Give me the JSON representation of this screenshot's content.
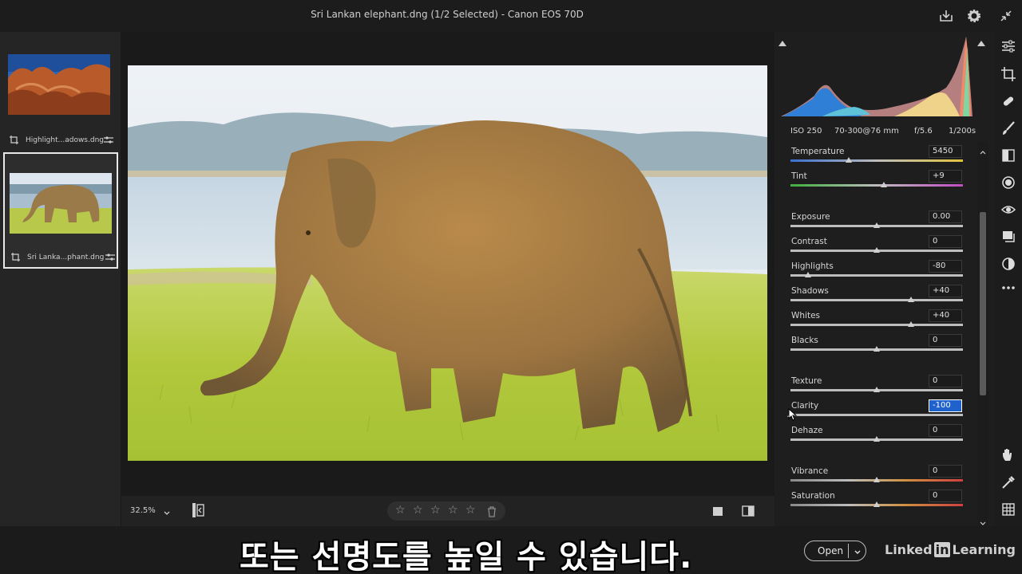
{
  "window": {
    "title": "Sri Lankan elephant.dng (1/2 Selected)  -  Canon EOS 70D"
  },
  "filmstrip": {
    "items": [
      {
        "label": "Highlight...adows.dng",
        "selected": false
      },
      {
        "label": "Sri Lanka...phant.dng",
        "selected": true
      }
    ]
  },
  "bottombar": {
    "zoom": "32.5%",
    "stars": [
      "☆",
      "☆",
      "☆",
      "☆",
      "☆"
    ]
  },
  "exif": {
    "iso": "ISO 250",
    "lens": "70-300@76 mm",
    "aperture": "f/5.6",
    "shutter": "1/200s"
  },
  "adjustments": [
    {
      "label": "Temperature",
      "value": "5450",
      "pos": 0.34,
      "track": "temp"
    },
    {
      "label": "Tint",
      "value": "+9",
      "pos": 0.54,
      "track": "tint"
    },
    {
      "label": "Exposure",
      "value": "0.00",
      "pos": 0.5,
      "track": "gray"
    },
    {
      "label": "Contrast",
      "value": "0",
      "pos": 0.5,
      "track": "gray"
    },
    {
      "label": "Highlights",
      "value": "-80",
      "pos": 0.1,
      "track": "gray"
    },
    {
      "label": "Shadows",
      "value": "+40",
      "pos": 0.7,
      "track": "gray"
    },
    {
      "label": "Whites",
      "value": "+40",
      "pos": 0.7,
      "track": "gray"
    },
    {
      "label": "Blacks",
      "value": "0",
      "pos": 0.5,
      "track": "gray"
    },
    {
      "label": "Texture",
      "value": "0",
      "pos": 0.5,
      "track": "gray"
    },
    {
      "label": "Clarity",
      "value": "-100",
      "pos": 0.0,
      "track": "gray",
      "active": true
    },
    {
      "label": "Dehaze",
      "value": "0",
      "pos": 0.5,
      "track": "gray"
    },
    {
      "label": "Vibrance",
      "value": "0",
      "pos": 0.5,
      "track": "vib"
    },
    {
      "label": "Saturation",
      "value": "0",
      "pos": 0.5,
      "track": "vib"
    }
  ],
  "footer": {
    "subtitle": "또는 선명도를 높일 수 있습니다.",
    "open_label": "Open",
    "brand_a": "Linked",
    "brand_in": "in",
    "brand_b": "Learning"
  },
  "colors": {
    "accent": "#1f62cc",
    "panel_bg": "#1e1e1e"
  }
}
